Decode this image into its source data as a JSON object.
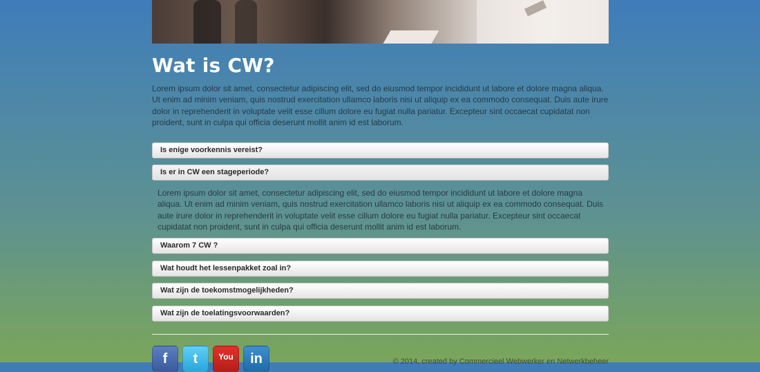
{
  "page": {
    "title": "Wat is CW?",
    "intro": "Lorem ipsum dolor sit amet, consectetur adipiscing elit, sed do eiusmod tempor incididunt ut labore et dolore magna aliqua. Ut enim ad minim veniam, quis nostrud exercitation ullamco laboris nisi ut aliquip ex ea commodo consequat. Duis aute irure dolor in reprehenderit in voluptate velit esse cillum dolore eu fugiat nulla pariatur. Excepteur sint occaecat cupidatat non proident, sunt in culpa qui officia deserunt mollit anim id est laborum."
  },
  "faq": {
    "items": [
      {
        "label": "Is enige voorkennis vereist?"
      },
      {
        "label": "Is er in CW een stageperiode?",
        "expanded": true
      },
      {
        "label": "Waarom 7 CW ?"
      },
      {
        "label": "Wat houdt het lessenpakket zoal in?"
      },
      {
        "label": "Wat zijn de toekomstmogelijkheden?"
      },
      {
        "label": "Wat zijn de toelatingsvoorwaarden?"
      }
    ],
    "open_panel_text": "Lorem ipsum dolor sit amet, consectetur adipiscing elit, sed do eiusmod tempor incididunt ut labore et dolore magna aliqua. Ut enim ad minim veniam, quis nostrud exercitation ullamco laboris nisi ut aliquip ex ea commodo consequat. Duis aute irure dolor in reprehenderit in voluptate velit esse cillum dolore eu fugiat nulla pariatur. Excepteur sint occaecat cupidatat non proident, sunt in culpa qui officia deserunt mollit anim id est laborum."
  },
  "footer": {
    "social": [
      {
        "icon": "facebook-icon",
        "glyph": "f"
      },
      {
        "icon": "twitter-icon",
        "glyph": "t"
      },
      {
        "icon": "youtube-icon",
        "glyph": "You"
      },
      {
        "icon": "linkedin-icon",
        "glyph": "in"
      }
    ],
    "copyright": "© 2014, created by Commercieel Webwerker en Netwerkbeheer"
  }
}
